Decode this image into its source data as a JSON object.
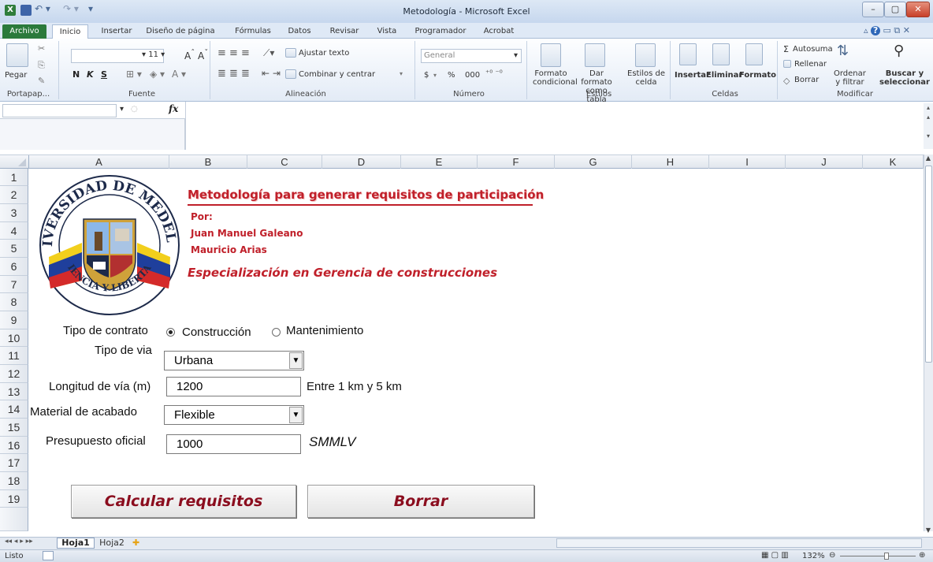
{
  "window": {
    "title": "Metodología - Microsoft Excel",
    "controls": [
      "–",
      "▢",
      "✕"
    ]
  },
  "ribbon_tabs": [
    "Archivo",
    "Inicio",
    "Insertar",
    "Diseño de página",
    "Fórmulas",
    "Datos",
    "Revisar",
    "Vista",
    "Programador",
    "Acrobat"
  ],
  "ribbon": {
    "clipboard": {
      "paste": "Pegar",
      "group": "Portapap..."
    },
    "font": {
      "size": "11",
      "bold": "N",
      "italic": "K",
      "underline": "S",
      "group": "Fuente"
    },
    "alignment": {
      "wrap": "Ajustar texto",
      "merge": "Combinar y centrar",
      "group": "Alineación"
    },
    "number": {
      "format": "General",
      "currency": "$",
      "percent": "%",
      "thousands": "000",
      "group": "Número"
    },
    "styles": {
      "cond_line1": "Formato",
      "cond_line2": "condicional",
      "table_line1": "Dar formato",
      "table_line2": "como tabla",
      "cell_line1": "Estilos de",
      "cell_line2": "celda",
      "group": "Estilos"
    },
    "cells": {
      "insert": "Insertar",
      "delete": "Eliminar",
      "format": "Formato",
      "group": "Celdas"
    },
    "editing": {
      "autosum": "Autosuma",
      "fill": "Rellenar",
      "clear": "Borrar",
      "sort_line1": "Ordenar",
      "sort_line2": "y filtrar",
      "find_line1": "Buscar y",
      "find_line2": "seleccionar",
      "group": "Modificar"
    }
  },
  "formula_bar": {
    "fx": "fx",
    "name_box": "",
    "value": ""
  },
  "columns": [
    "A",
    "B",
    "C",
    "D",
    "E",
    "F",
    "G",
    "H",
    "I",
    "J",
    "K"
  ],
  "rows": [
    "1",
    "2",
    "3",
    "4",
    "5",
    "6",
    "7",
    "8",
    "9",
    "10",
    "11",
    "12",
    "13",
    "14",
    "15",
    "16",
    "17",
    "18",
    "19"
  ],
  "logo": {
    "top_text": "UNIVERSIDAD DE MEDELLIN",
    "bottom_text": "CIENCIA Y LIBERTAD"
  },
  "header": {
    "title": "Metodología para generar requisitos de participación",
    "by": "Por:",
    "author1": "Juan Manuel Galeano",
    "author2": "Mauricio Arias",
    "program": "Especialización en Gerencia de construcciones"
  },
  "form": {
    "contract_label": "Tipo de contrato",
    "option_construction": "Construcción",
    "option_maintenance": "Mantenimiento",
    "road_type_label": "Tipo de via",
    "road_type_value": "Urbana",
    "length_label": "Longitud de vía (m)",
    "length_value": "1200",
    "length_hint": "Entre 1 km y 5 km",
    "material_label": "Material de acabado",
    "material_value": "Flexible",
    "budget_label": "Presupuesto oficial",
    "budget_value": "1000",
    "budget_unit": "SMMLV",
    "calculate_button": "Calcular requisitos",
    "clear_button": "Borrar"
  },
  "sheet_tabs": [
    "Hoja1",
    "Hoja2"
  ],
  "status": {
    "ready": "Listo",
    "zoom": "132%"
  }
}
